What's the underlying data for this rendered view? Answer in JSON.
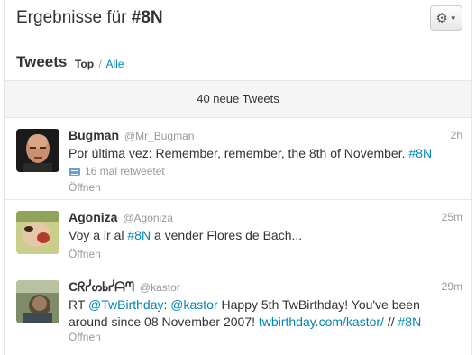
{
  "header": {
    "title_prefix": "Ergebnisse für ",
    "title_query": "#8N",
    "gear_icon": "gear-icon"
  },
  "subhead": {
    "tweets_label": "Tweets",
    "filter_top": "Top",
    "separator": "/",
    "filter_all": "Alle"
  },
  "new_tweets_bar": "40 neue Tweets",
  "tweets": [
    {
      "fullname": "Bugman",
      "username": "@Mr_Bugman",
      "time": "2h",
      "text_1": "Por última vez: Remember, remember, the 8th of November. ",
      "hashtag_1": "#8N",
      "retweet_count": "16 mal retweetet",
      "open": "Öffnen"
    },
    {
      "fullname": "Agoniza",
      "username": "@Agoniza",
      "time": "25m",
      "text_1": "Voy a ir al ",
      "hashtag_1": "#8N",
      "text_2": " a vender Flores de Bach...",
      "open": "Öffnen"
    },
    {
      "fullname": "Cᖇᓰᔕᖯᓰᗩᘉ",
      "username": "@kastor",
      "time": "29m",
      "text_1": "RT ",
      "mention_1": "@TwBirthday",
      "text_2": ": ",
      "mention_2": "@kastor",
      "text_3": " Happy 5th TwBirthday! You've been around since 08 November 2007! ",
      "link_1": "twbirthday.com/kastor/",
      "text_4": " // ",
      "hashtag_1": "#8N",
      "open": "Öffnen"
    }
  ]
}
